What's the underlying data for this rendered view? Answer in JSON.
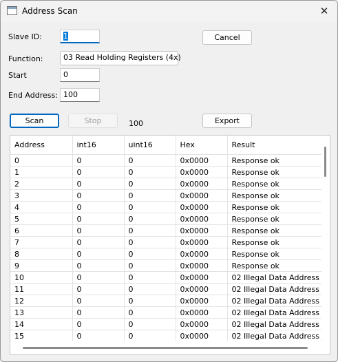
{
  "window": {
    "title": "Address Scan"
  },
  "form": {
    "slave_id_label": "Slave ID:",
    "slave_id_value": "1",
    "function_label": "Function:",
    "function_value": "03 Read Holding Registers (4x)",
    "start_label": "Start",
    "start_value": "0",
    "end_label": "End Address:",
    "end_value": "100"
  },
  "buttons": {
    "cancel": "Cancel",
    "scan": "Scan",
    "stop": "Stop",
    "export": "Export"
  },
  "status": {
    "count": "100"
  },
  "table": {
    "columns": [
      "Address",
      "int16",
      "uint16",
      "Hex",
      "Result"
    ],
    "rows": [
      [
        "0",
        "0",
        "0",
        "0x0000",
        "Response ok"
      ],
      [
        "1",
        "0",
        "0",
        "0x0000",
        "Response ok"
      ],
      [
        "2",
        "0",
        "0",
        "0x0000",
        "Response ok"
      ],
      [
        "3",
        "0",
        "0",
        "0x0000",
        "Response ok"
      ],
      [
        "4",
        "0",
        "0",
        "0x0000",
        "Response ok"
      ],
      [
        "5",
        "0",
        "0",
        "0x0000",
        "Response ok"
      ],
      [
        "6",
        "0",
        "0",
        "0x0000",
        "Response ok"
      ],
      [
        "7",
        "0",
        "0",
        "0x0000",
        "Response ok"
      ],
      [
        "8",
        "0",
        "0",
        "0x0000",
        "Response ok"
      ],
      [
        "9",
        "0",
        "0",
        "0x0000",
        "Response ok"
      ],
      [
        "10",
        "0",
        "0",
        "0x0000",
        "02 Illegal Data Address"
      ],
      [
        "11",
        "0",
        "0",
        "0x0000",
        "02 Illegal Data Address"
      ],
      [
        "12",
        "0",
        "0",
        "0x0000",
        "02 Illegal Data Address"
      ],
      [
        "13",
        "0",
        "0",
        "0x0000",
        "02 Illegal Data Address"
      ],
      [
        "14",
        "0",
        "0",
        "0x0000",
        "02 Illegal Data Address"
      ],
      [
        "15",
        "0",
        "0",
        "0x0000",
        "02 Illegal Data Address"
      ]
    ]
  },
  "colors": {
    "accent": "#0067c0",
    "selection": "#0078d7"
  },
  "icons": {
    "app": "window-icon",
    "close": "close-icon",
    "dropdown": "chevron-down-icon"
  }
}
